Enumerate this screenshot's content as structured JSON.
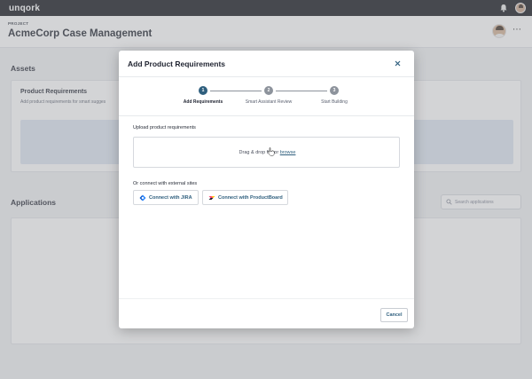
{
  "app": {
    "logo": "unqork"
  },
  "project": {
    "label": "PROJECT",
    "title": "AcmeCorp Case Management"
  },
  "assets": {
    "title": "Assets",
    "card_title": "Product Requirements",
    "card_subtitle": "Add product requirements for smart sugges"
  },
  "applications": {
    "title": "Applications",
    "search_placeholder": "Search applications"
  },
  "modal": {
    "title": "Add Product Requirements",
    "steps": [
      {
        "number": "1",
        "label": "Add Requirements",
        "active": true
      },
      {
        "number": "2",
        "label": "Smart Assistant Review",
        "active": false
      },
      {
        "number": "3",
        "label": "Start Building",
        "active": false
      }
    ],
    "upload_label": "Upload product requirements",
    "drop_text": "Drag & drop file or",
    "browse": "browse",
    "connect_label": "Or connect with external sites",
    "connect_jira": "Connect with JIRA",
    "connect_productboard": "Connect with ProductBoard",
    "cancel": "Cancel"
  },
  "colors": {
    "accent": "#2f5f7e",
    "inactive_step": "#8d939c",
    "topbar": "#0f1117"
  },
  "icons": {
    "notifications": "bell-icon",
    "close": "close-icon",
    "search": "search-icon",
    "more": "more-horizontal-icon",
    "jira": "jira-icon",
    "productboard": "productboard-icon",
    "cursor": "hand-cursor-icon"
  }
}
